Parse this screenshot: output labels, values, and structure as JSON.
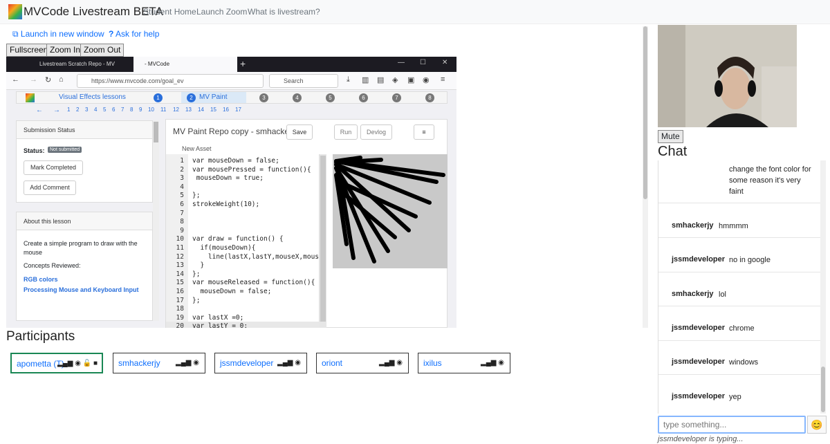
{
  "navbar": {
    "brand": "MVCode Livestream BETA",
    "links": [
      "Student Home",
      "Launch Zoom",
      "What is livestream?"
    ]
  },
  "actions": {
    "launch_new_window": "Launch in new window",
    "ask_help": "Ask for help",
    "fullscreen": "Fullscreen",
    "zoom_in": "Zoom In",
    "zoom_out": "Zoom Out"
  },
  "screen": {
    "tabs": [
      "Livestream Scratch Repo - MV",
      "- MVCode"
    ],
    "url": "https://www.mvcode.com/goal_ev",
    "search_placeholder": "Search",
    "lesson_bar": {
      "course": "Visual Effects lessons",
      "current": "MV Paint",
      "numbers": [
        "1",
        "2",
        "3",
        "4",
        "5",
        "6",
        "7",
        "8"
      ]
    },
    "pages": [
      "1",
      "2",
      "3",
      "4",
      "5",
      "6",
      "7",
      "8",
      "9",
      "10",
      "11",
      "12",
      "13",
      "14",
      "15",
      "16",
      "17"
    ],
    "submission": {
      "header": "Submission Status",
      "status_label": "Status:",
      "status_value": "Not submitted",
      "mark_completed": "Mark Completed",
      "add_comment": "Add Comment"
    },
    "about": {
      "header": "About this lesson",
      "description": "Create a simple program to draw with the mouse",
      "concepts_label": "Concepts Reviewed:",
      "concepts": [
        "RGB colors",
        "Processing Mouse and Keyboard Input"
      ]
    },
    "editor": {
      "title": "MV Paint Repo copy - smhackerjy",
      "save": "Save",
      "run": "Run",
      "devlog": "Devlog",
      "new_asset": "New Asset",
      "lines": [
        {
          "n": "1",
          "t": "var mouseDown = false;"
        },
        {
          "n": "2",
          "t": "var mousePressed = function(){"
        },
        {
          "n": "3",
          "t": " mouseDown = true;"
        },
        {
          "n": "4",
          "t": ""
        },
        {
          "n": "5",
          "t": "};"
        },
        {
          "n": "6",
          "t": "strokeWeight(10);"
        },
        {
          "n": "7",
          "t": ""
        },
        {
          "n": "8",
          "t": ""
        },
        {
          "n": "9",
          "t": ""
        },
        {
          "n": "10",
          "t": "var draw = function() {"
        },
        {
          "n": "11",
          "t": "  if(mouseDown){"
        },
        {
          "n": "12",
          "t": "    line(lastX,lastY,mouseX,mous"
        },
        {
          "n": "13",
          "t": "  }"
        },
        {
          "n": "14",
          "t": "};"
        },
        {
          "n": "15",
          "t": "var mouseReleased = function(){"
        },
        {
          "n": "16",
          "t": "  mouseDown = false;"
        },
        {
          "n": "17",
          "t": "};"
        },
        {
          "n": "18",
          "t": ""
        },
        {
          "n": "19",
          "t": "var lastX =0;"
        },
        {
          "n": "20",
          "t": "var lastY = 0;"
        }
      ]
    }
  },
  "participants": {
    "title": "Participants",
    "list": [
      {
        "name": "apometta (T)",
        "icons": "📶🔇🔓🎥"
      },
      {
        "name": "smhackerjy",
        "icons": "📶🔇"
      },
      {
        "name": "jssmdeveloper",
        "icons": "📶🔇"
      },
      {
        "name": "oriont",
        "icons": "📶🔇"
      },
      {
        "name": "ixilus",
        "icons": "📶🔇"
      }
    ]
  },
  "video": {
    "mute": "Mute"
  },
  "chat": {
    "title": "Chat",
    "messages": [
      {
        "user": "",
        "text": "change the font color for some reason it's very faint"
      },
      {
        "user": "smhackerjy",
        "text": "hmmmm"
      },
      {
        "user": "jssmdeveloper",
        "text": "no in google"
      },
      {
        "user": "smhackerjy",
        "text": "lol"
      },
      {
        "user": "jssmdeveloper",
        "text": "chrome"
      },
      {
        "user": "jssmdeveloper",
        "text": "windows"
      },
      {
        "user": "jssmdeveloper",
        "text": "yep"
      }
    ],
    "input_placeholder": "type something...",
    "emoji": "😊",
    "typing": "jssmdeveloper is typing..."
  }
}
